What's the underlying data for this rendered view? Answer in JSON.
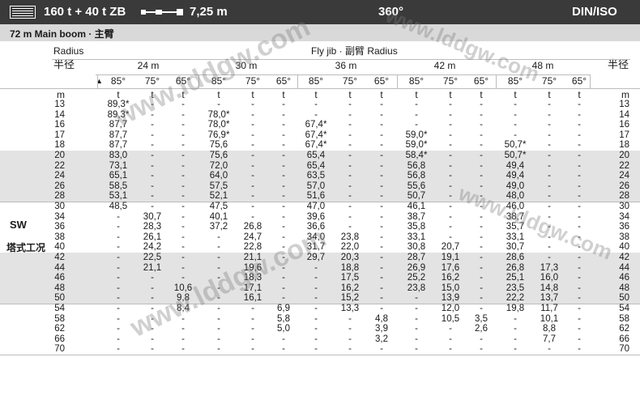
{
  "header": {
    "capacity": "160 t + 40 t ZB",
    "jib_length": "7,25 m",
    "slew": "360°",
    "standard": "DIN/ISO"
  },
  "subheader": {
    "boom": "72 m  Main boom · 主臂"
  },
  "table": {
    "radius_label": "Radius",
    "radius_cn": "半径",
    "radius_cn_right": "半径",
    "flyjib_label": "Fly jib · 副臂 Radius",
    "jib_lengths": [
      "24 m",
      "30 m",
      "36 m",
      "42 m",
      "48 m"
    ],
    "angles": [
      "85°",
      "75°",
      "65°",
      "85°",
      "75°",
      "65°",
      "85°",
      "75°",
      "65°",
      "85°",
      "75°",
      "65°",
      "85°",
      "75°",
      "65°"
    ],
    "unit_m": "m",
    "unit_t": "t",
    "side_label_en": "SW",
    "side_label_cn": "塔式工况",
    "rows": [
      {
        "r": "13",
        "v": [
          "89,3*",
          "-",
          "-",
          "-",
          "-",
          "-",
          "-",
          "-",
          "-",
          "-",
          "-",
          "-",
          "-",
          "-",
          "-"
        ]
      },
      {
        "r": "14",
        "v": [
          "89,3*",
          "-",
          "-",
          "78,0*",
          "-",
          "-",
          "-",
          "-",
          "-",
          "-",
          "-",
          "-",
          "-",
          "-",
          "-"
        ]
      },
      {
        "r": "16",
        "v": [
          "87,7",
          "-",
          "-",
          "78,0*",
          "-",
          "-",
          "67,4*",
          "-",
          "-",
          "-",
          "-",
          "-",
          "-",
          "-",
          "-"
        ]
      },
      {
        "r": "17",
        "v": [
          "87,7",
          "-",
          "-",
          "76,9*",
          "-",
          "-",
          "67,4*",
          "-",
          "-",
          "59,0*",
          "-",
          "-",
          "-",
          "-",
          "-"
        ]
      },
      {
        "r": "18",
        "v": [
          "87,7",
          "-",
          "-",
          "75,6",
          "-",
          "-",
          "67,4*",
          "-",
          "-",
          "59,0*",
          "-",
          "-",
          "50,7*",
          "-",
          "-"
        ]
      },
      {
        "r": "20",
        "v": [
          "83,0",
          "-",
          "-",
          "75,6",
          "-",
          "-",
          "65,4",
          "-",
          "-",
          "58,4*",
          "-",
          "-",
          "50,7*",
          "-",
          "-"
        ]
      },
      {
        "r": "22",
        "v": [
          "73,1",
          "-",
          "-",
          "72,0",
          "-",
          "-",
          "65,4",
          "-",
          "-",
          "56,8",
          "-",
          "-",
          "49,4",
          "-",
          "-"
        ]
      },
      {
        "r": "24",
        "v": [
          "65,1",
          "-",
          "-",
          "64,0",
          "-",
          "-",
          "63,5",
          "-",
          "-",
          "56,8",
          "-",
          "-",
          "49,4",
          "-",
          "-"
        ]
      },
      {
        "r": "26",
        "v": [
          "58,5",
          "-",
          "-",
          "57,5",
          "-",
          "-",
          "57,0",
          "-",
          "-",
          "55,6",
          "-",
          "-",
          "49,0",
          "-",
          "-"
        ]
      },
      {
        "r": "28",
        "v": [
          "53,1",
          "-",
          "-",
          "52,1",
          "-",
          "-",
          "51,6",
          "-",
          "-",
          "50,7",
          "-",
          "-",
          "48,0",
          "-",
          "-"
        ]
      },
      {
        "r": "30",
        "v": [
          "48,5",
          "-",
          "-",
          "47,5",
          "-",
          "-",
          "47,0",
          "-",
          "-",
          "46,1",
          "-",
          "-",
          "46,0",
          "-",
          "-"
        ]
      },
      {
        "r": "34",
        "v": [
          "-",
          "30,7",
          "-",
          "40,1",
          "-",
          "-",
          "39,6",
          "-",
          "-",
          "38,7",
          "-",
          "-",
          "38,7",
          "-",
          "-"
        ]
      },
      {
        "r": "36",
        "v": [
          "-",
          "28,3",
          "-",
          "37,2",
          "26,8",
          "-",
          "36,6",
          "-",
          "-",
          "35,8",
          "-",
          "-",
          "35,7",
          "-",
          "-"
        ]
      },
      {
        "r": "38",
        "v": [
          "-",
          "26,1",
          "-",
          "-",
          "24,7",
          "-",
          "34,0",
          "23,8",
          "-",
          "33,1",
          "-",
          "-",
          "33,1",
          "-",
          "-"
        ]
      },
      {
        "r": "40",
        "v": [
          "-",
          "24,2",
          "-",
          "-",
          "22,8",
          "-",
          "31,7",
          "22,0",
          "-",
          "30,8",
          "20,7",
          "-",
          "30,7",
          "-",
          "-"
        ]
      },
      {
        "r": "42",
        "v": [
          "-",
          "22,5",
          "-",
          "-",
          "21,1",
          "-",
          "29,7",
          "20,3",
          "-",
          "28,7",
          "19,1",
          "-",
          "28,6",
          "-",
          "-"
        ]
      },
      {
        "r": "44",
        "v": [
          "-",
          "21,1",
          "-",
          "-",
          "19,6",
          "-",
          "-",
          "18,8",
          "-",
          "26,9",
          "17,6",
          "-",
          "26,8",
          "17,3",
          "-"
        ]
      },
      {
        "r": "46",
        "v": [
          "-",
          "-",
          "-",
          "-",
          "18,3",
          "-",
          "-",
          "17,5",
          "-",
          "25,2",
          "16,2",
          "-",
          "25,1",
          "16,0",
          "-"
        ]
      },
      {
        "r": "48",
        "v": [
          "-",
          "-",
          "10,6",
          "-",
          "17,1",
          "-",
          "-",
          "16,2",
          "-",
          "23,8",
          "15,0",
          "-",
          "23,5",
          "14,8",
          "-"
        ]
      },
      {
        "r": "50",
        "v": [
          "-",
          "-",
          "9,8",
          "-",
          "16,1",
          "-",
          "-",
          "15,2",
          "-",
          "-",
          "13,9",
          "-",
          "22,2",
          "13,7",
          "-"
        ]
      },
      {
        "r": "54",
        "v": [
          "-",
          "-",
          "8,4",
          "-",
          "-",
          "6,9",
          "-",
          "13,3",
          "-",
          "-",
          "12,0",
          "-",
          "19,8",
          "11,7",
          "-"
        ]
      },
      {
        "r": "58",
        "v": [
          "-",
          "-",
          "-",
          "-",
          "-",
          "5,8",
          "-",
          "-",
          "4,8",
          "-",
          "10,5",
          "3,5",
          "-",
          "10,1",
          "-"
        ]
      },
      {
        "r": "62",
        "v": [
          "-",
          "-",
          "-",
          "-",
          "-",
          "5,0",
          "-",
          "-",
          "3,9",
          "-",
          "-",
          "2,6",
          "-",
          "8,8",
          "-"
        ]
      },
      {
        "r": "66",
        "v": [
          "-",
          "-",
          "-",
          "-",
          "-",
          "-",
          "-",
          "-",
          "3,2",
          "-",
          "-",
          "-",
          "-",
          "7,7",
          "-"
        ]
      },
      {
        "r": "70",
        "v": [
          "-",
          "-",
          "-",
          "-",
          "-",
          "-",
          "-",
          "-",
          "-",
          "-",
          "-",
          "-",
          "-",
          "-",
          "-"
        ]
      }
    ]
  },
  "watermark": "www.lddgw.com"
}
